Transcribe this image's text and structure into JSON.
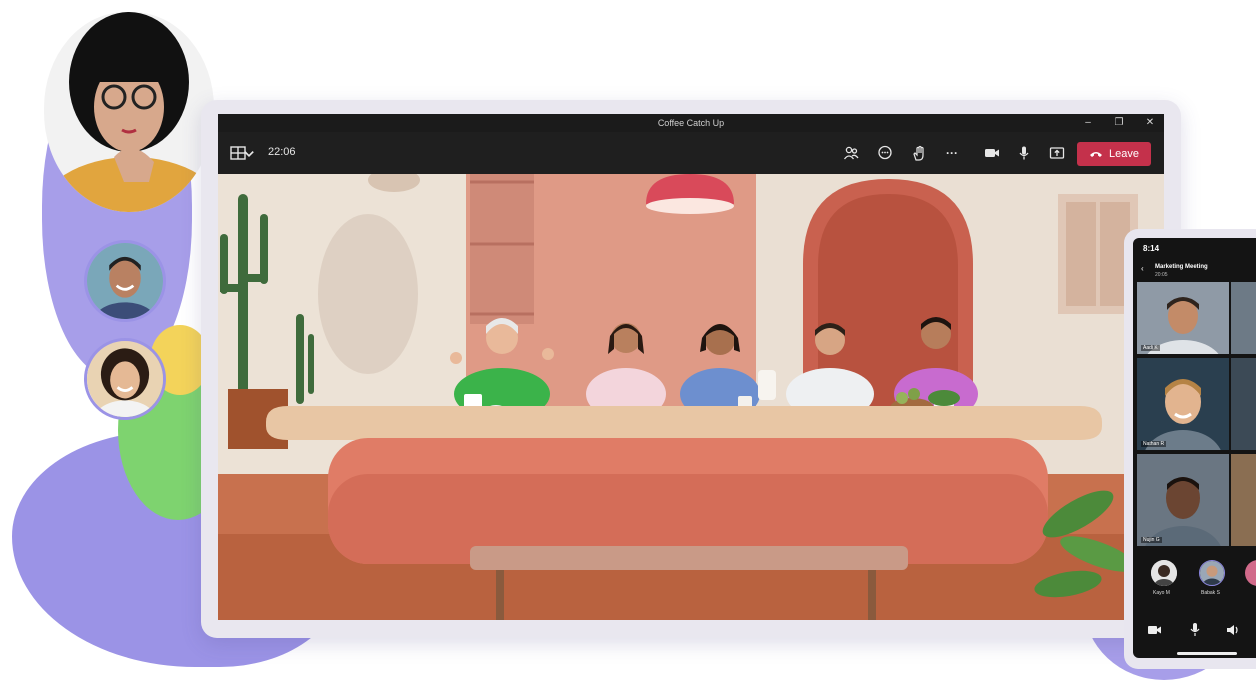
{
  "window": {
    "title": "Coffee Catch Up",
    "minimize": "–",
    "restore": "❐",
    "close": "✕"
  },
  "toolbar": {
    "timer": "22:06",
    "leave_label": "Leave",
    "more_label": "···"
  },
  "phone": {
    "time": "8:14",
    "meeting_title": "Marketing Meeting",
    "meeting_subtitle": "20:05",
    "tiles": [
      {
        "name": "Aadi K"
      },
      {
        "name": "Nathan R"
      },
      {
        "name": "Nujin G"
      }
    ],
    "bottom_row": [
      {
        "name": "Kayo M"
      },
      {
        "name": "Babak S"
      }
    ]
  },
  "colors": {
    "leave": "#c4314b",
    "purple_blob": "#9b93e6",
    "green_blob": "#7ed36f",
    "yellow_blob": "#f3d35a",
    "room_wall": "#e39a86",
    "table": "#e07c66"
  }
}
